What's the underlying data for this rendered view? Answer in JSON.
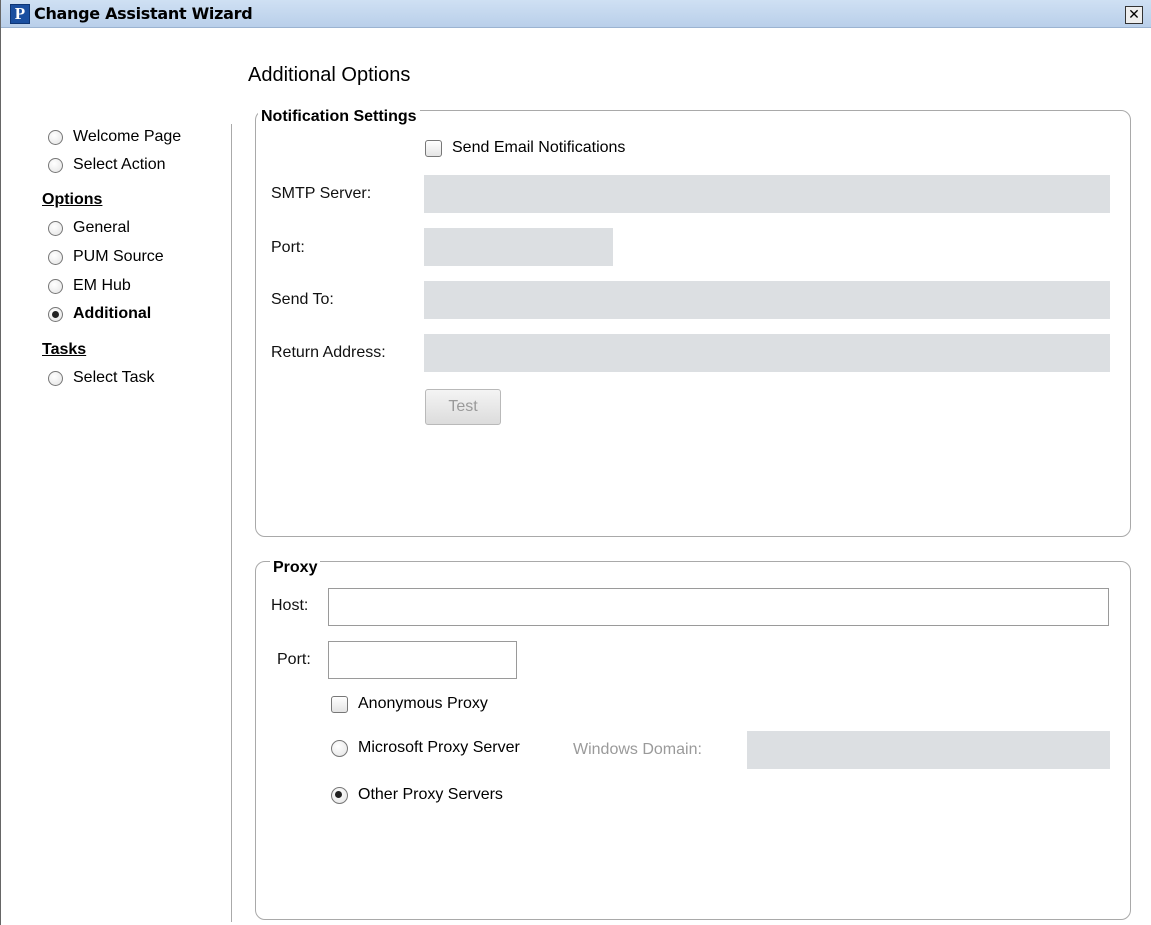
{
  "window": {
    "title": "Change Assistant Wizard",
    "app_icon_letter": "P",
    "close_glyph": "✕"
  },
  "page": {
    "title": "Additional Options"
  },
  "sidebar": {
    "items_top": [
      {
        "label": "Welcome Page",
        "selected": false
      },
      {
        "label": "Select Action",
        "selected": false
      }
    ],
    "options_heading": "Options",
    "options_items": [
      {
        "label": "General",
        "selected": false
      },
      {
        "label": "PUM Source",
        "selected": false
      },
      {
        "label": "EM Hub",
        "selected": false
      },
      {
        "label": "Additional",
        "selected": true
      }
    ],
    "tasks_heading": "Tasks",
    "tasks_items": [
      {
        "label": "Select Task",
        "selected": false
      }
    ]
  },
  "notification": {
    "group_title": "Notification Settings",
    "send_email_label": "Send Email Notifications",
    "send_email_checked": false,
    "smtp_label": "SMTP Server:",
    "smtp_value": "",
    "port_label": "Port:",
    "port_value": "",
    "send_to_label": "Send To:",
    "send_to_value": "",
    "return_label": "Return Address:",
    "return_value": "",
    "test_button": "Test"
  },
  "proxy": {
    "group_title": "Proxy",
    "host_label": "Host:",
    "host_value": "",
    "port_label": "Port:",
    "port_value": "",
    "anonymous_label": "Anonymous Proxy",
    "anonymous_checked": false,
    "ms_proxy_label": "Microsoft Proxy Server",
    "ms_proxy_selected": false,
    "windows_domain_label": "Windows Domain:",
    "windows_domain_value": "",
    "other_proxy_label": "Other Proxy Servers",
    "other_proxy_selected": true
  },
  "colors": {
    "disabled_field": "#dcdfe2",
    "titlebar": "#c4d8ef",
    "group_border": "#a9a9a9"
  }
}
